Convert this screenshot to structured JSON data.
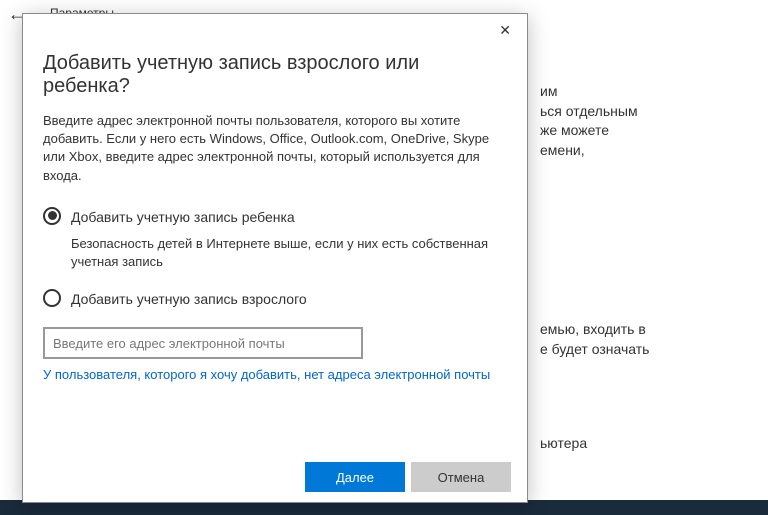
{
  "background": {
    "header_label": "Параметры",
    "text1": "им\nься отдельным\nже можете\nемени,",
    "text2": "емью, входить в\nе будет означать",
    "text3": "ьютера"
  },
  "dialog": {
    "title": "Добавить учетную запись взрослого или ребенка?",
    "description": "Введите адрес электронной почты пользователя, которого вы хотите добавить. Если у него есть Windows, Office, Outlook.com, OneDrive, Skype или Xbox, введите адрес электронной почты, который используется для входа.",
    "radio_child_label": "Добавить учетную запись ребенка",
    "radio_child_note": "Безопасность детей в Интернете выше, если у них есть собственная учетная запись",
    "radio_adult_label": "Добавить учетную запись взрослого",
    "email_placeholder": "Введите его адрес электронной почты",
    "no_email_link": "У пользователя, которого я хочу добавить, нет адреса электронной почты",
    "next_button": "Далее",
    "cancel_button": "Отмена"
  }
}
